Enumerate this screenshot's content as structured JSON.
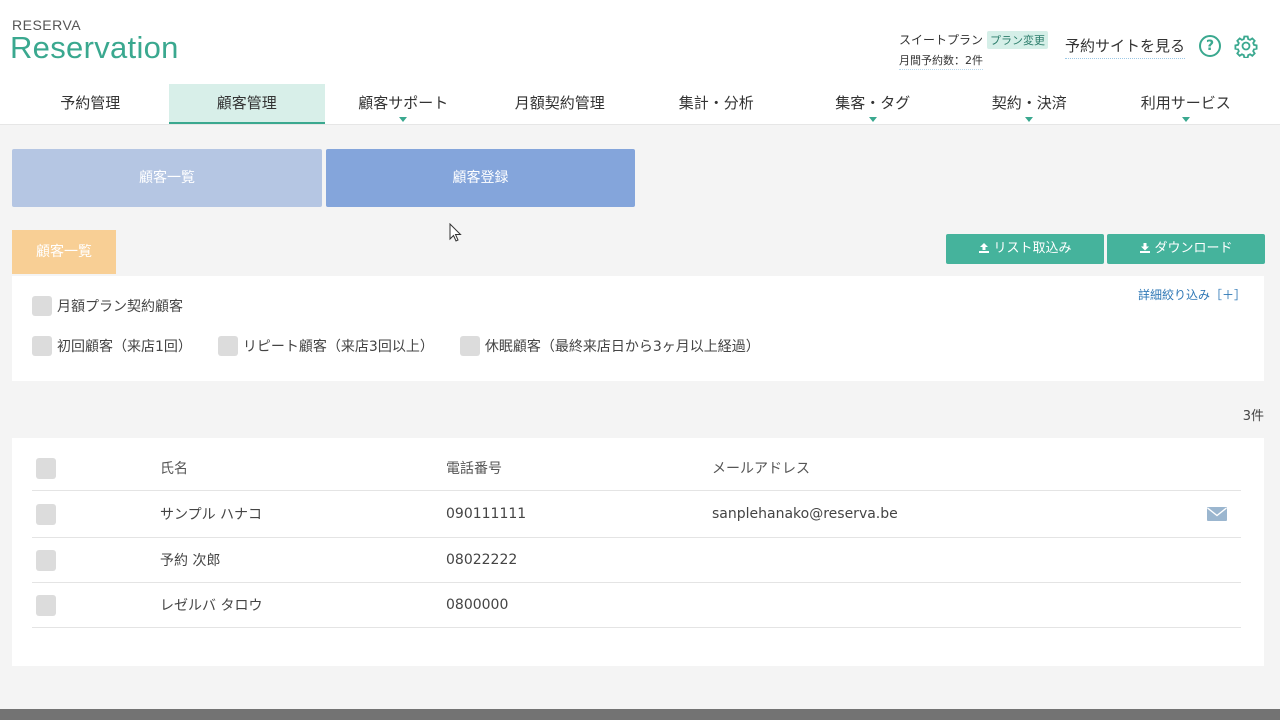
{
  "header": {
    "logo_small": "RESERVA",
    "logo_main": "Reservation",
    "plan_name": "スイートプラン",
    "plan_change": "プラン変更",
    "monthly_reservations": "月間予約数：2件",
    "view_site": "予約サイトを見る",
    "help_glyph": "?"
  },
  "nav": {
    "items": [
      {
        "label": "予約管理"
      },
      {
        "label": "顧客管理"
      },
      {
        "label": "顧客サポート"
      },
      {
        "label": "月額契約管理"
      },
      {
        "label": "集計・分析"
      },
      {
        "label": "集客・タグ"
      },
      {
        "label": "契約・決済"
      },
      {
        "label": "利用サービス"
      }
    ]
  },
  "tabs": {
    "list": "顧客一覧",
    "register": "顧客登録"
  },
  "section": {
    "title": "顧客一覧",
    "import": "リスト取込み",
    "download": "ダウンロード"
  },
  "filters": {
    "detail": "詳細絞り込み［＋］",
    "monthly": "月額プラン契約顧客",
    "first": "初回顧客（来店1回）",
    "repeat": "リピート顧客（来店3回以上）",
    "dormant": "休眠顧客（最終来店日から3ヶ月以上経過）"
  },
  "count": "3件",
  "table": {
    "headers": {
      "name": "氏名",
      "phone": "電話番号",
      "email": "メールアドレス"
    },
    "rows": [
      {
        "name": "サンプル ハナコ",
        "phone": "090111111",
        "email": "sanplehanako@reserva.be"
      },
      {
        "name": "予約 次郎",
        "phone": "08022222",
        "email": ""
      },
      {
        "name": "レゼルバ タロウ",
        "phone": "0800000",
        "email": ""
      }
    ]
  },
  "colors": {
    "accent": "#3aa88f",
    "tab_list": "#b5c6e3",
    "tab_register": "#84a5db",
    "section_tag": "#f8cf95",
    "action_button": "#45b39c"
  },
  "icons": [
    "help-icon",
    "gear-icon",
    "upload-icon",
    "download-icon",
    "mail-icon",
    "mouse-cursor-icon"
  ]
}
